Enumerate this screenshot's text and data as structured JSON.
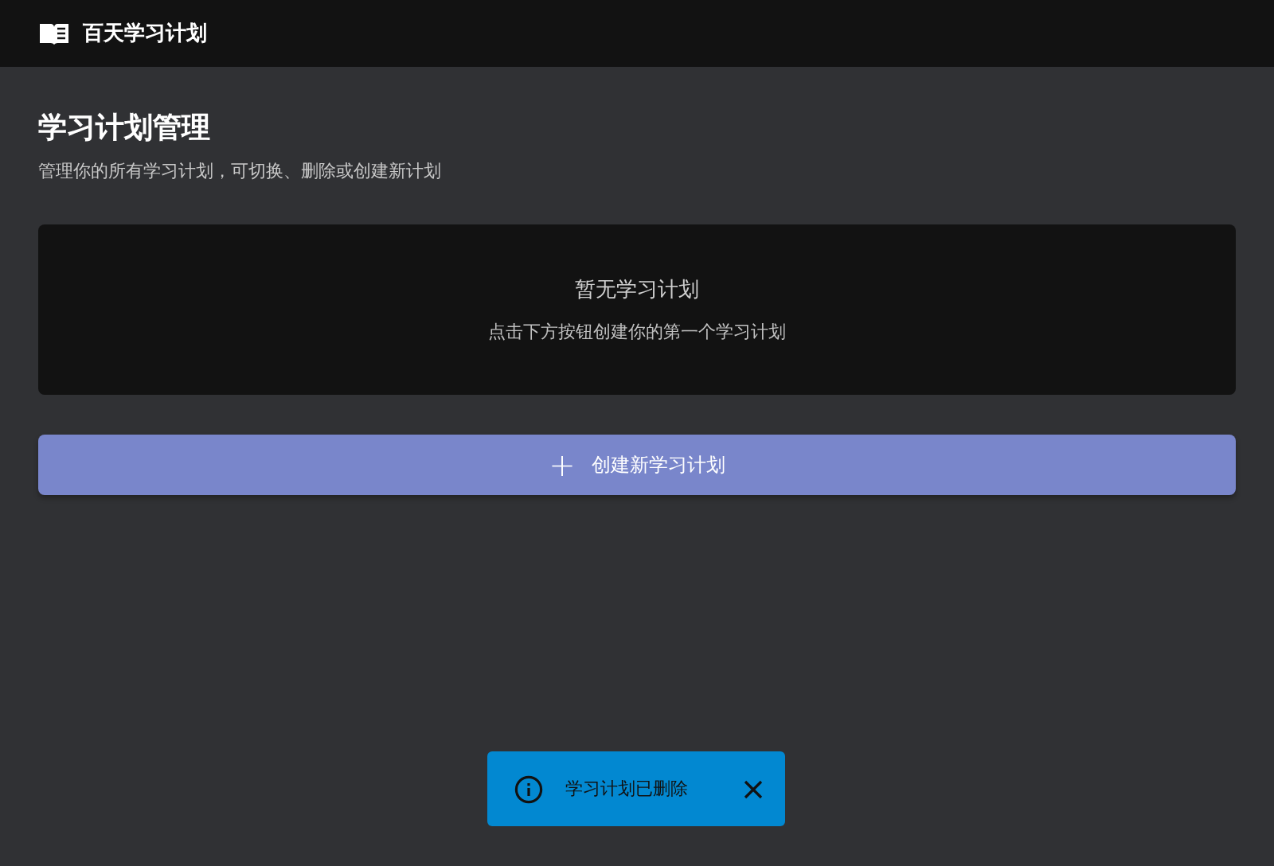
{
  "app_bar": {
    "title": "百天学习计划"
  },
  "page": {
    "title": "学习计划管理",
    "subtitle": "管理你的所有学习计划，可切换、删除或创建新计划"
  },
  "empty_state": {
    "title": "暂无学习计划",
    "hint": "点击下方按钮创建你的第一个学习计划"
  },
  "create_button": {
    "icon": "+",
    "label": "创建新学习计划"
  },
  "toast": {
    "message": "学习计划已删除"
  }
}
